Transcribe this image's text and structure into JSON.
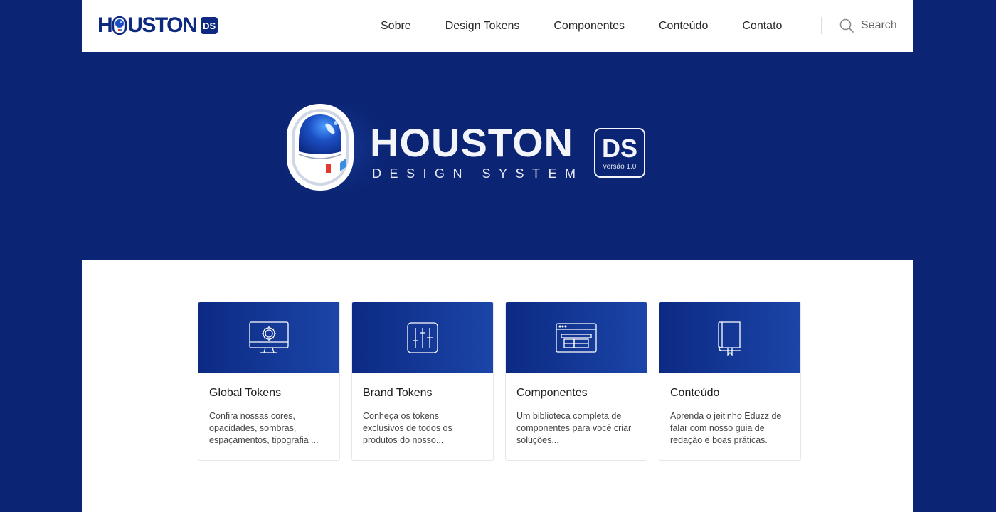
{
  "header": {
    "logo_word_start": "H",
    "logo_word_end": "USTON",
    "logo_badge": "DS",
    "nav": [
      "Sobre",
      "Design Tokens",
      "Componentes",
      "Conteúdo",
      "Contato"
    ],
    "search_label": "Search"
  },
  "hero": {
    "title": "HOUSTON",
    "subtitle": "DESIGN SYSTEM",
    "badge": "DS",
    "version": "versão 1.0"
  },
  "cards": [
    {
      "icon": "monitor-gear-icon",
      "title": "Global Tokens",
      "description": "Confira nossas cores, opacidades, sombras, espaçamentos, tipografia ..."
    },
    {
      "icon": "sliders-icon",
      "title": "Brand Tokens",
      "description": "Conheça os tokens exclusivos de todos os produtos do nosso..."
    },
    {
      "icon": "browser-layout-icon",
      "title": "Componentes",
      "description": "Um biblioteca completa de componentes para você criar soluções..."
    },
    {
      "icon": "book-icon",
      "title": "Conteúdo",
      "description": "Aprenda o jeitinho Eduzz de falar com nosso guia de redação e boas práticas."
    }
  ],
  "colors": {
    "brand_navy": "#0b2574",
    "card_gradient_start": "#0c2a83",
    "card_gradient_end": "#1b45a8",
    "helmet_red": "#e5392f",
    "helmet_blue": "#3a8de0"
  }
}
